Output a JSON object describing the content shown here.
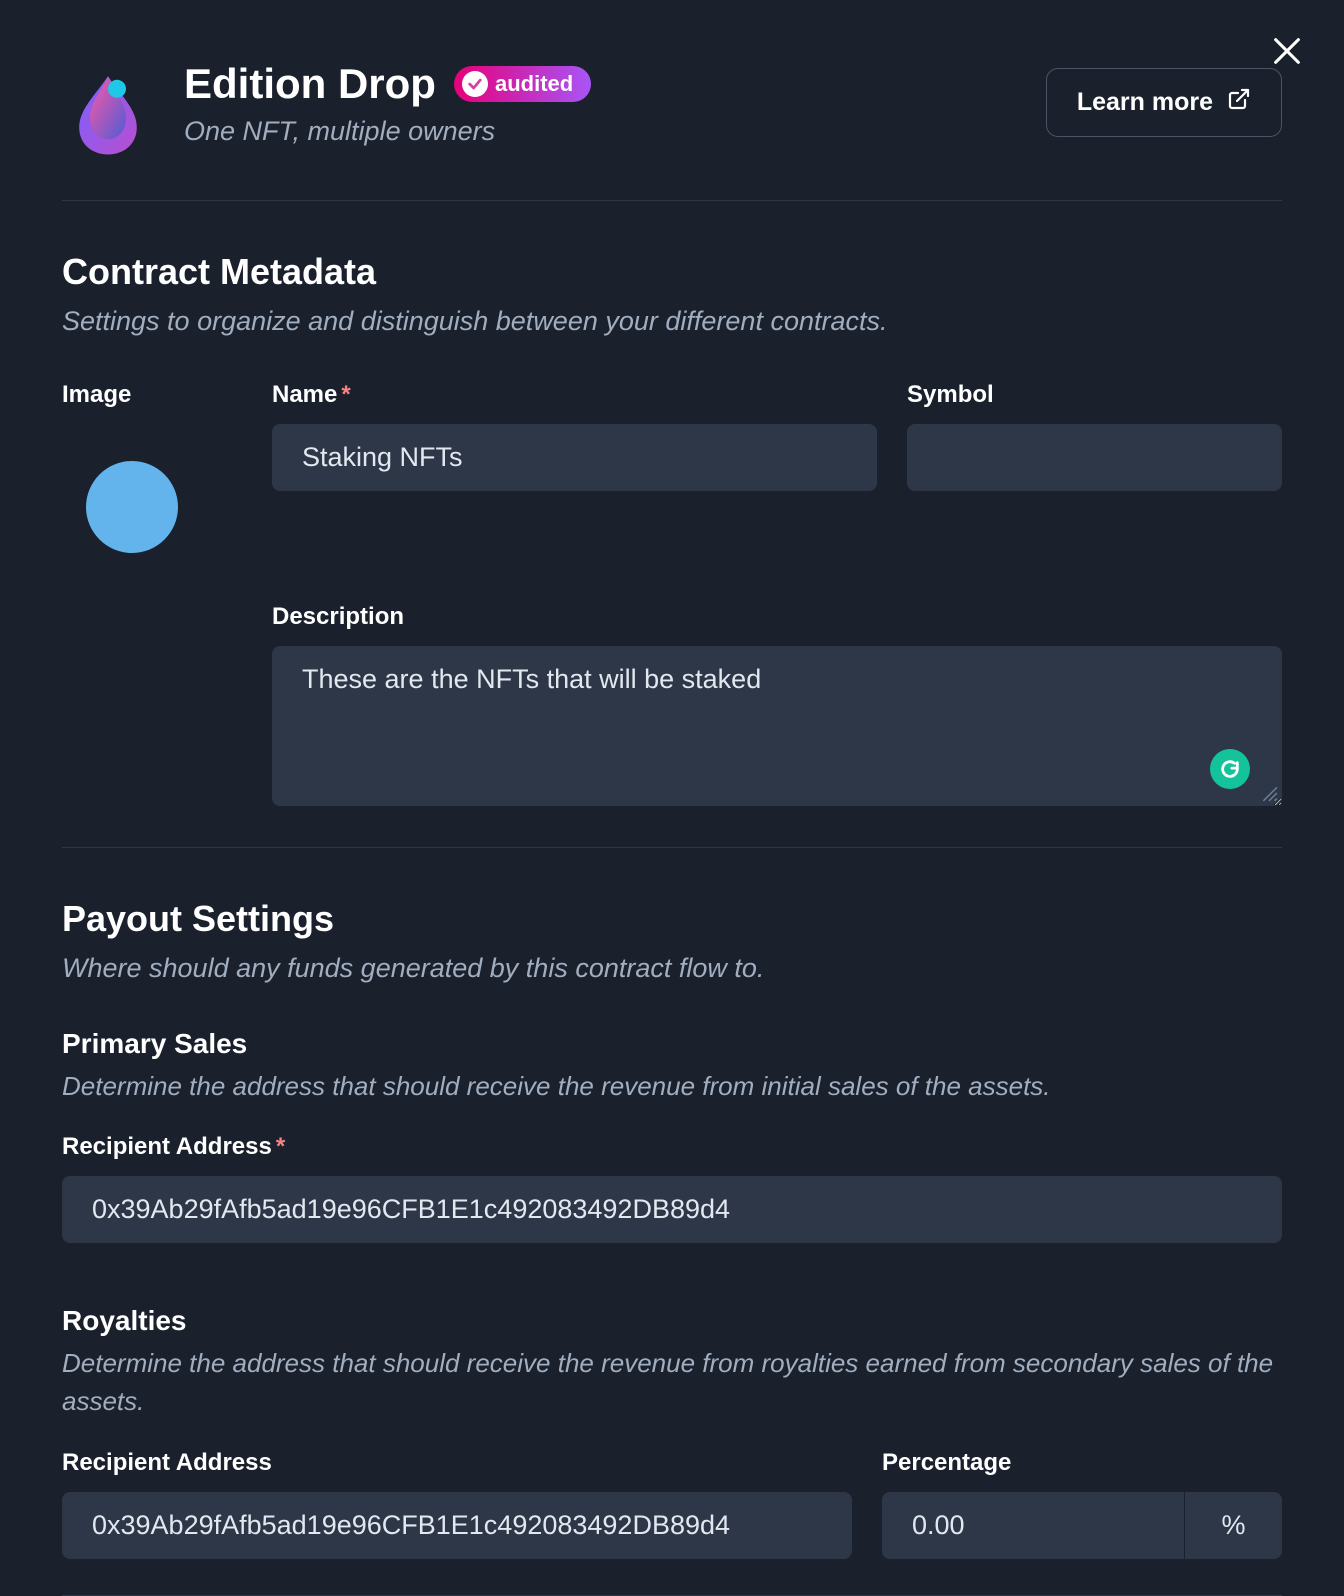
{
  "header": {
    "title": "Edition Drop",
    "audited_label": "audited",
    "subtitle": "One NFT, multiple owners",
    "learn_more_label": "Learn more"
  },
  "metadata": {
    "section_title": "Contract Metadata",
    "section_desc": "Settings to organize and distinguish between your different contracts.",
    "image_label": "Image",
    "name_label": "Name",
    "name_value": "Staking NFTs",
    "symbol_label": "Symbol",
    "symbol_value": "",
    "description_label": "Description",
    "description_value": "These are the NFTs that will be staked"
  },
  "payout": {
    "section_title": "Payout Settings",
    "section_desc": "Where should any funds generated by this contract flow to.",
    "primary_title": "Primary Sales",
    "primary_desc": "Determine the address that should receive the revenue from initial sales of the assets.",
    "recipient_label": "Recipient Address",
    "recipient_value": "0x39Ab29fAfb5ad19e96CFB1E1c492083492DB89d4",
    "royalties_title": "Royalties",
    "royalties_desc": "Determine the address that should receive the revenue from royalties earned from secondary sales of the assets.",
    "royalty_recipient_label": "Recipient Address",
    "royalty_recipient_value": "0x39Ab29fAfb5ad19e96CFB1E1c492083492DB89d4",
    "percentage_label": "Percentage",
    "percentage_value": "0.00",
    "percentage_unit": "%"
  }
}
